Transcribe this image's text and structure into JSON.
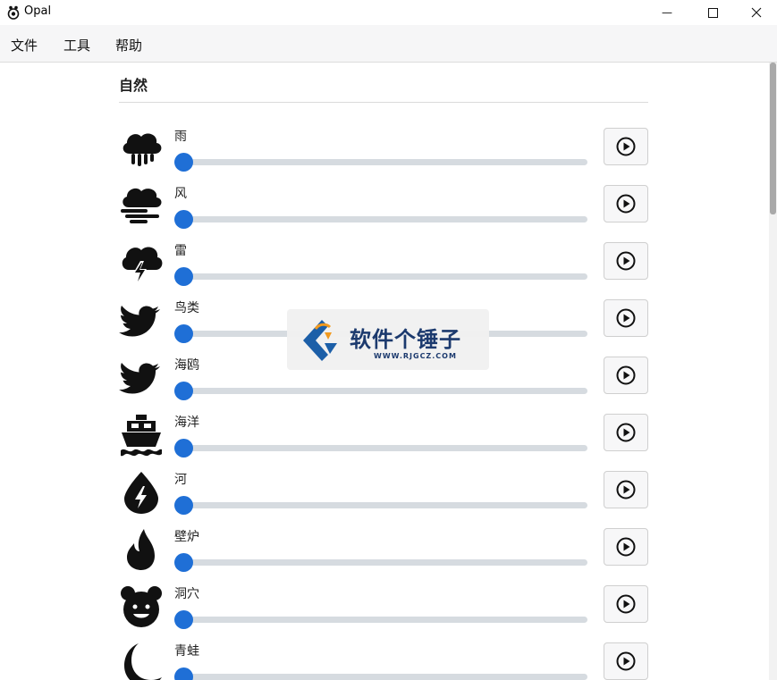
{
  "window": {
    "title": "Opal",
    "min_glyph": "—",
    "max_glyph": "☐",
    "close_glyph": "✕"
  },
  "menu": {
    "items": [
      "文件",
      "工具",
      "帮助"
    ]
  },
  "section": {
    "title": "自然"
  },
  "sounds": [
    {
      "label": "雨",
      "icon": "rain-cloud-icon",
      "volume": 0
    },
    {
      "label": "风",
      "icon": "wind-cloud-icon",
      "volume": 0
    },
    {
      "label": "雷",
      "icon": "thunder-cloud-icon",
      "volume": 0
    },
    {
      "label": "鸟类",
      "icon": "bird-icon",
      "volume": 0
    },
    {
      "label": "海鸥",
      "icon": "bird-icon",
      "volume": 0
    },
    {
      "label": "海洋",
      "icon": "ship-icon",
      "volume": 0
    },
    {
      "label": "河",
      "icon": "water-drop-icon",
      "volume": 0
    },
    {
      "label": "壁炉",
      "icon": "fire-icon",
      "volume": 0
    },
    {
      "label": "洞穴",
      "icon": "bear-icon",
      "volume": 0
    },
    {
      "label": "青蛙",
      "icon": "moon-icon",
      "volume": 0
    }
  ],
  "watermark": {
    "brand": "软件个锤子",
    "url": "WWW.RJGCZ.COM"
  },
  "colors": {
    "accent": "#1f6fd6",
    "track": "#d6dbe0"
  }
}
